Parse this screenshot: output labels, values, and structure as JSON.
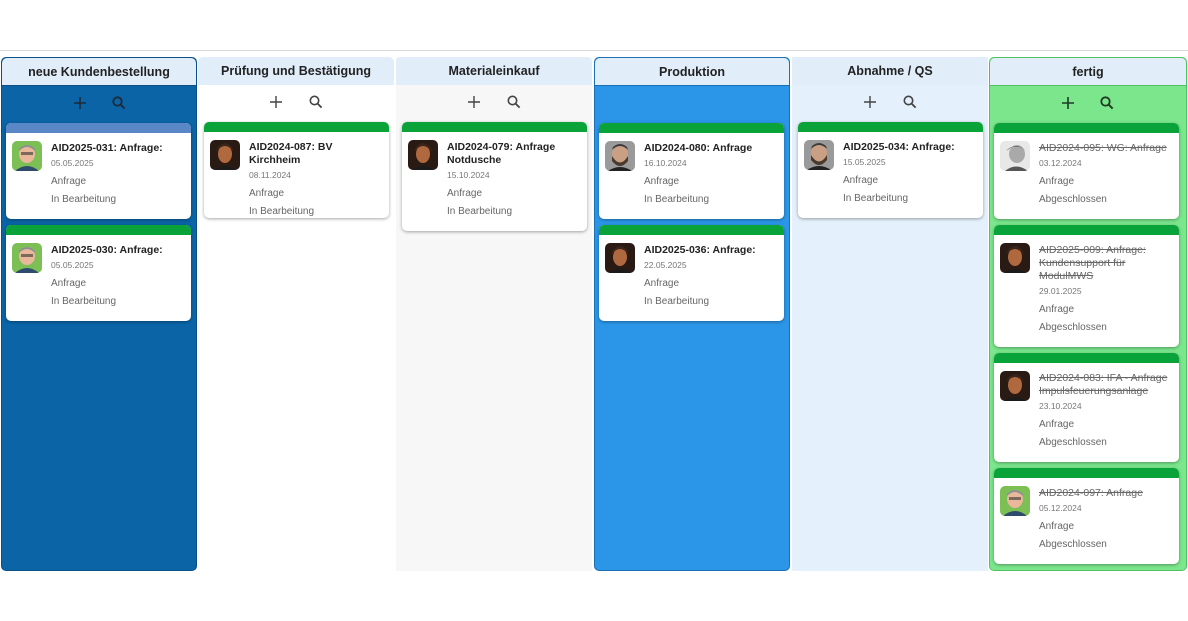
{
  "board": {
    "columns": [
      {
        "title": "neue Kundenbestellung",
        "cards": [
          {
            "title": "AID2025-031: Anfrage:",
            "date": "05.05.2025",
            "type": "Anfrage",
            "status": "In Bearbeitung"
          },
          {
            "title": "AID2025-030: Anfrage:",
            "date": "05.05.2025",
            "type": "Anfrage",
            "status": "In Bearbeitung"
          }
        ]
      },
      {
        "title": "Prüfung und Bestätigung",
        "cards": [
          {
            "title": "AID2024-087: BV Kirchheim",
            "date": "08.11.2024",
            "type": "Anfrage",
            "status": "In Bearbeitung"
          }
        ]
      },
      {
        "title": "Materialeinkauf",
        "cards": [
          {
            "title": "AID2024-079: Anfrage Notdusche",
            "date": "15.10.2024",
            "type": "Anfrage",
            "status": "In Bearbeitung"
          }
        ]
      },
      {
        "title": "Produktion",
        "cards": [
          {
            "title": "AID2024-080: Anfrage",
            "date": "16.10.2024",
            "type": "Anfrage",
            "status": "In Bearbeitung"
          },
          {
            "title": "AID2025-036: Anfrage:",
            "date": "22.05.2025",
            "type": "Anfrage",
            "status": "In Bearbeitung"
          }
        ]
      },
      {
        "title": "Abnahme / QS",
        "cards": [
          {
            "title": "AID2025-034: Anfrage:",
            "date": "15.05.2025",
            "type": "Anfrage",
            "status": "In Bearbeitung"
          }
        ]
      },
      {
        "title": "fertig",
        "cards": [
          {
            "title": "AID2024-095: WG: Anfrage",
            "date": "03.12.2024",
            "type": "Anfrage",
            "status": "Abgeschlossen"
          },
          {
            "title": "AID2025-009: Anfrage: Kundensupport für ModulMWS",
            "date": "29.01.2025",
            "type": "Anfrage",
            "status": "Abgeschlossen"
          },
          {
            "title": "AID2024-083: IFA - Anfrage Impulsfeuerungsanlage",
            "date": "23.10.2024",
            "type": "Anfrage",
            "status": "Abgeschlossen"
          },
          {
            "title": "AID2024-097: Anfrage",
            "date": "05.12.2024",
            "type": "Anfrage",
            "status": "Abgeschlossen"
          }
        ]
      }
    ]
  },
  "icons": {
    "add": "plus-icon",
    "search": "search-icon"
  },
  "colors": {
    "col1_bg": "#0b64a6",
    "col2_bg": "#ffffff",
    "col3_bg": "#f7f7f7",
    "col4_bg": "#2b96e8",
    "col5_bg": "#e4f0fb",
    "col6_bg": "#7be68c",
    "header_bg": "#e1eefa",
    "card_bar_green": "#0aa33a",
    "card_bar_blue": "#5a87c6"
  }
}
